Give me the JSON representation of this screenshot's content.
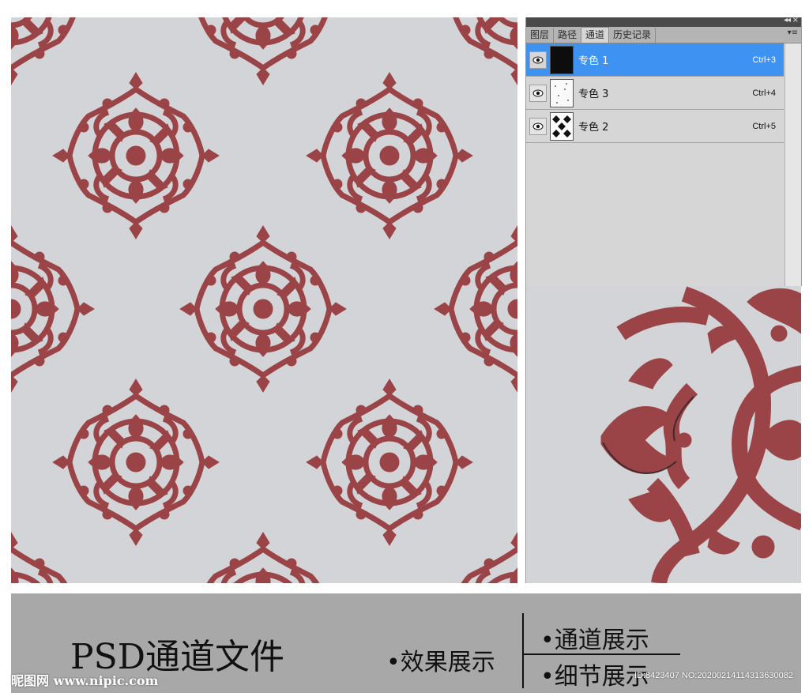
{
  "colors": {
    "pattern_background": "#d3d4d8",
    "motif": "#9b4447",
    "selection": "#3d92f2",
    "panel": "#d6d6d6",
    "footer": "#a8a8a8"
  },
  "channels_panel": {
    "collapse_icon": "double-chevron-left-icon",
    "close_icon": "close-icon",
    "tabs": [
      {
        "label": "图层"
      },
      {
        "label": "路径"
      },
      {
        "label": "通道"
      },
      {
        "label": "历史记录"
      }
    ],
    "active_tab": "通道",
    "menu_icon": "panel-menu-icon",
    "channels": [
      {
        "name": "专色 1",
        "shortcut": "Ctrl+3",
        "selected": true,
        "thumbnail": "solid-black"
      },
      {
        "name": "专色 3",
        "shortcut": "Ctrl+4",
        "selected": false,
        "thumbnail": "white-speckled"
      },
      {
        "name": "专色 2",
        "shortcut": "Ctrl+5",
        "selected": false,
        "thumbnail": "black-white-pattern"
      }
    ]
  },
  "footer": {
    "title": "PSD通道文件",
    "effect_label": "•效果展示",
    "channel_label": "•通道展示",
    "detail_label": "•细节展示",
    "watermark_site": "昵图网 www.nipic.com",
    "watermark_id": "ID:8423407 NO:20200214114313630082"
  }
}
